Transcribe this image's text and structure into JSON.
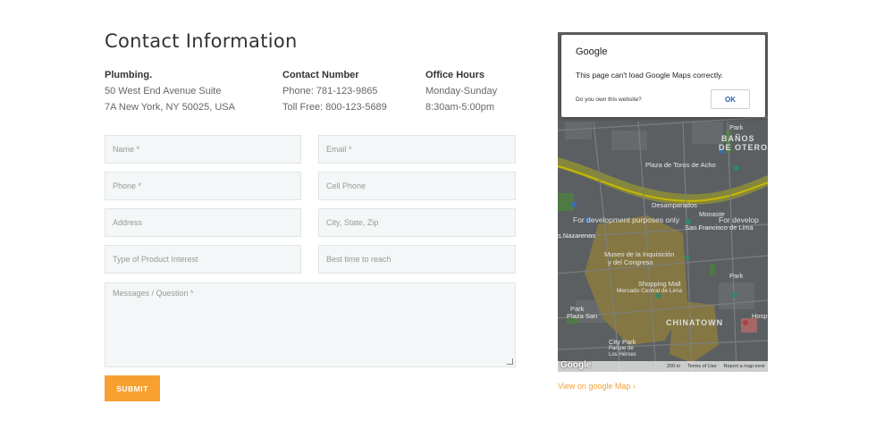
{
  "heading": "Contact Information",
  "info": {
    "plumbing": {
      "title": "Plumbing.",
      "line1": "50 West End Avenue Suite",
      "line2": "7A New York, NY 50025, USA"
    },
    "contact": {
      "title": "Contact Number",
      "line1": "Phone: 781-123-9865",
      "line2": "Toll Free: 800-123-5689"
    },
    "hours": {
      "title": "Office Hours",
      "line1": "Monday-Sunday",
      "line2": "8:30am-5:00pm"
    }
  },
  "form": {
    "name": "Name *",
    "email": "Email *",
    "phone": "Phone *",
    "cell": "Cell Phone",
    "address": "Address",
    "city": "City, State, Zip",
    "product": "Type of Product Interest",
    "best_time": "Best time to reach",
    "message": "Messages / Question *",
    "submit": "SUBMIT"
  },
  "map": {
    "dialog_brand": "Google",
    "dialog_message": "This page can't load Google Maps correctly.",
    "dialog_question": "Do you own this website?",
    "dialog_ok": "OK",
    "dev_text": "For development purposes only",
    "dev_text_2": "For develop",
    "labels": {
      "banos": "BAÑOS",
      "de_otero": "DE OTERO",
      "plaza_toros": "Plaza de Toros de Acho",
      "desamparados": "Desamparados",
      "monastery": "Monaste",
      "san_francisco": "San Francisco de Lima",
      "nazarenas": "s Nazarenas",
      "museo1": "Museo de la Inquisición",
      "museo2": "y del Congreso",
      "shopping": "Shopping Mall",
      "mercado": "Mercado Central de Lima",
      "park1": "Park",
      "park2": "Park",
      "park3": "Park",
      "plaza_san": "Plaza San",
      "chinatown": "CHINATOWN",
      "hosp": "Hosp",
      "city_park": "City Park",
      "parque": "Parque de",
      "heroes": "Los Héroes"
    },
    "footer_scale": "200 m",
    "footer_terms": "Terms of Use",
    "footer_report": "Report a map error",
    "logo": "Google",
    "link": "View on google Map ›"
  }
}
